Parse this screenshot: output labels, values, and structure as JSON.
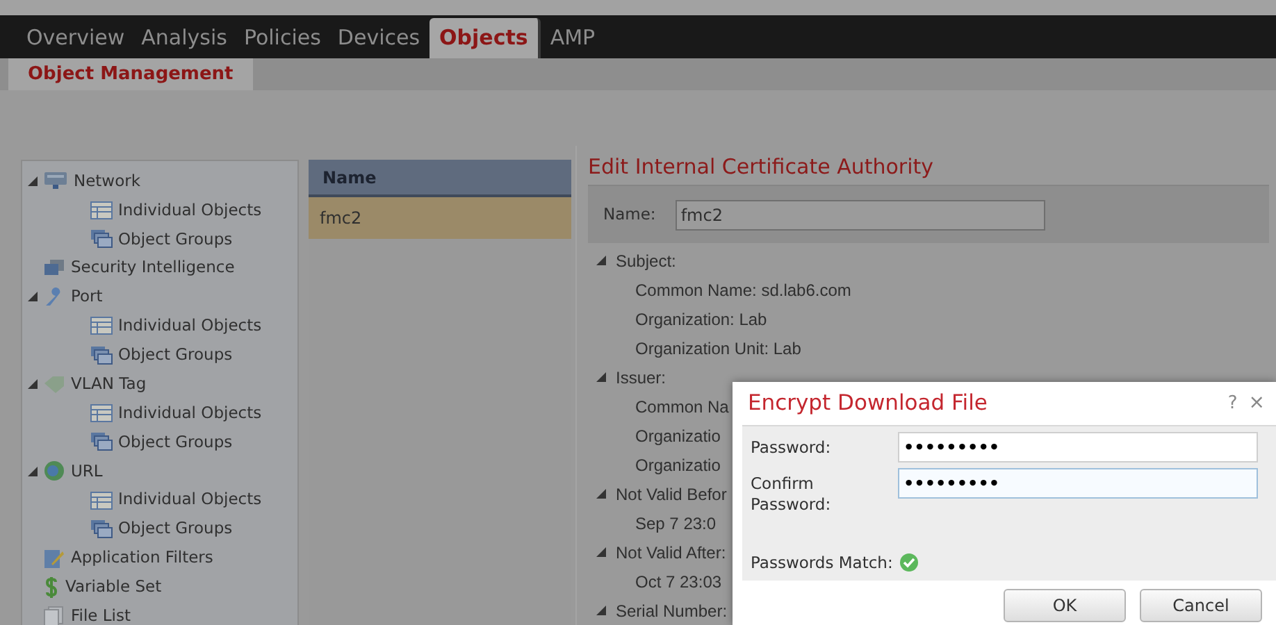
{
  "nav": {
    "tabs": [
      {
        "label": "Overview",
        "selected": false
      },
      {
        "label": "Analysis",
        "selected": false
      },
      {
        "label": "Policies",
        "selected": false
      },
      {
        "label": "Devices",
        "selected": false
      },
      {
        "label": "Objects",
        "selected": true
      },
      {
        "label": "AMP",
        "selected": false
      }
    ]
  },
  "subnav": {
    "tabs": [
      {
        "label": "Object Management",
        "selected": true
      }
    ]
  },
  "sidebar": {
    "items": [
      {
        "label": "Network",
        "expanded": true,
        "children": [
          {
            "label": "Individual Objects"
          },
          {
            "label": "Object Groups"
          }
        ]
      },
      {
        "label": "Security Intelligence",
        "expanded": false
      },
      {
        "label": "Port",
        "expanded": true,
        "children": [
          {
            "label": "Individual Objects"
          },
          {
            "label": "Object Groups"
          }
        ]
      },
      {
        "label": "VLAN Tag",
        "expanded": true,
        "children": [
          {
            "label": "Individual Objects"
          },
          {
            "label": "Object Groups"
          }
        ]
      },
      {
        "label": "URL",
        "expanded": true,
        "children": [
          {
            "label": "Individual Objects"
          },
          {
            "label": "Object Groups"
          }
        ]
      },
      {
        "label": "Application Filters",
        "expanded": false
      },
      {
        "label": "Variable Set",
        "expanded": false
      },
      {
        "label": "File List",
        "expanded": false
      }
    ]
  },
  "table": {
    "columns": [
      "Name"
    ],
    "rows": [
      {
        "name": "fmc2",
        "selected": true
      }
    ]
  },
  "editor": {
    "title": "Edit Internal Certificate Authority",
    "name_label": "Name:",
    "name_value": "fmc2",
    "sections": [
      {
        "label": "Subject:",
        "expanded": true,
        "children": [
          "Common Name: sd.lab6.com",
          "Organization: Lab",
          "Organization Unit: Lab"
        ]
      },
      {
        "label": "Issuer:",
        "expanded": true,
        "children": [
          "Common Na",
          "Organizatio",
          "Organizatio"
        ]
      },
      {
        "label": "Not Valid Befor",
        "expanded": true,
        "children": [
          "Sep 7 23:0"
        ]
      },
      {
        "label": "Not Valid After:",
        "expanded": true,
        "children": [
          "Oct 7 23:03"
        ]
      },
      {
        "label": "Serial Number:",
        "expanded": true
      }
    ]
  },
  "dialog": {
    "title": "Encrypt Download File",
    "help": "?",
    "close": "×",
    "fields": [
      {
        "label": "Password:",
        "value": "•••••••••",
        "focused": false
      },
      {
        "label": "Confirm Password:",
        "value": "•••••••••",
        "focused": true
      }
    ],
    "match_label": "Passwords Match:",
    "match": true,
    "buttons": [
      "OK",
      "Cancel"
    ]
  }
}
